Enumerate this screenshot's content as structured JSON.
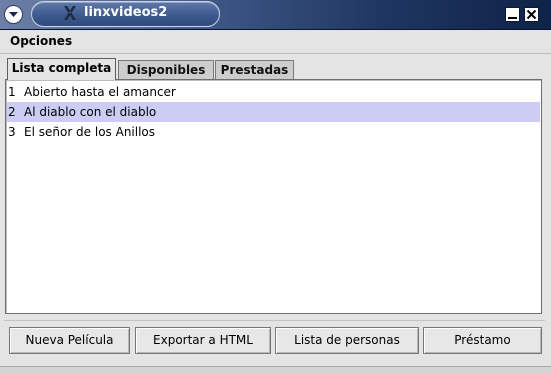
{
  "window": {
    "title": "linxvideos2"
  },
  "menubar": {
    "items": [
      {
        "label": "Opciones"
      }
    ]
  },
  "tabs": [
    {
      "label": "Lista completa",
      "active": true
    },
    {
      "label": "Disponibles",
      "active": false
    },
    {
      "label": "Prestadas",
      "active": false
    }
  ],
  "movie_list": [
    {
      "num": "1",
      "title": "Abierto hasta el amancer",
      "selected": false
    },
    {
      "num": "2",
      "title": "Al diablo con el diablo",
      "selected": true
    },
    {
      "num": "3",
      "title": "El señor de los Anillos",
      "selected": false
    }
  ],
  "buttons": [
    {
      "label": "Nueva Película"
    },
    {
      "label": "Exportar a HTML"
    },
    {
      "label": "Lista de personas"
    },
    {
      "label": "Préstamo"
    }
  ],
  "colors": {
    "title_bar": "#1f3561",
    "selection": "#ccccf5",
    "panel_bg": "#e4e4e4"
  },
  "icons": {
    "window_menu": "chevron-down-icon",
    "logo": "x-logo-icon",
    "minimize": "minimize-icon",
    "close": "close-icon"
  }
}
